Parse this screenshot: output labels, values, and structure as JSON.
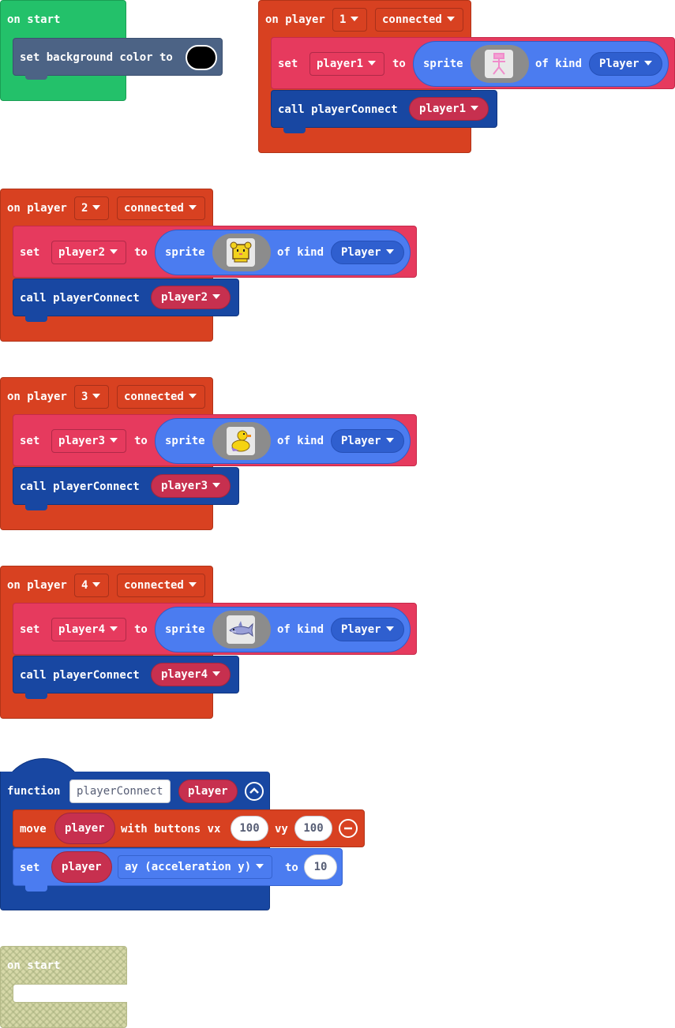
{
  "colors": {
    "event_green": "#23c16a",
    "event_orange": "#d84121",
    "set_pink": "#e63a5e",
    "call_blue": "#1847a2",
    "scene_slate": "#4c6385",
    "sprite_blue": "#4b7cf0",
    "bg_color_value": "#000000"
  },
  "on_start": {
    "hat_label": "on start",
    "set_bg_label": "set background color to"
  },
  "player_events": [
    {
      "on_label": "on player",
      "number": "1",
      "event": "connected",
      "set_label": "set",
      "var": "player1",
      "to_label": "to",
      "sprite_label": "sprite",
      "of_kind_label": "of kind",
      "kind": "Player",
      "call_label": "call playerConnect",
      "arg": "player1",
      "sprite_icon": "pink-stick-figure-icon"
    },
    {
      "on_label": "on player",
      "number": "2",
      "event": "connected",
      "set_label": "set",
      "var": "player2",
      "to_label": "to",
      "sprite_label": "sprite",
      "of_kind_label": "of kind",
      "kind": "Player",
      "call_label": "call playerConnect",
      "arg": "player2",
      "sprite_icon": "yellow-hamster-icon"
    },
    {
      "on_label": "on player",
      "number": "3",
      "event": "connected",
      "set_label": "set",
      "var": "player3",
      "to_label": "to",
      "sprite_label": "sprite",
      "of_kind_label": "of kind",
      "kind": "Player",
      "call_label": "call playerConnect",
      "arg": "player3",
      "sprite_icon": "yellow-duck-icon"
    },
    {
      "on_label": "on player",
      "number": "4",
      "event": "connected",
      "set_label": "set",
      "var": "player4",
      "to_label": "to",
      "sprite_label": "sprite",
      "of_kind_label": "of kind",
      "kind": "Player",
      "call_label": "call playerConnect",
      "arg": "player4",
      "sprite_icon": "shark-icon"
    }
  ],
  "function_block": {
    "function_label": "function",
    "name": "playerConnect",
    "param": "player",
    "move_label": "move",
    "move_var": "player",
    "with_buttons_label": "with buttons vx",
    "vx": "100",
    "vy_label": "vy",
    "vy": "100",
    "set_label": "set",
    "set_var": "player",
    "property": "ay (acceleration y)",
    "to_label": "to",
    "to_value": "10"
  },
  "disabled_on_start": {
    "hat_label": "on start"
  }
}
